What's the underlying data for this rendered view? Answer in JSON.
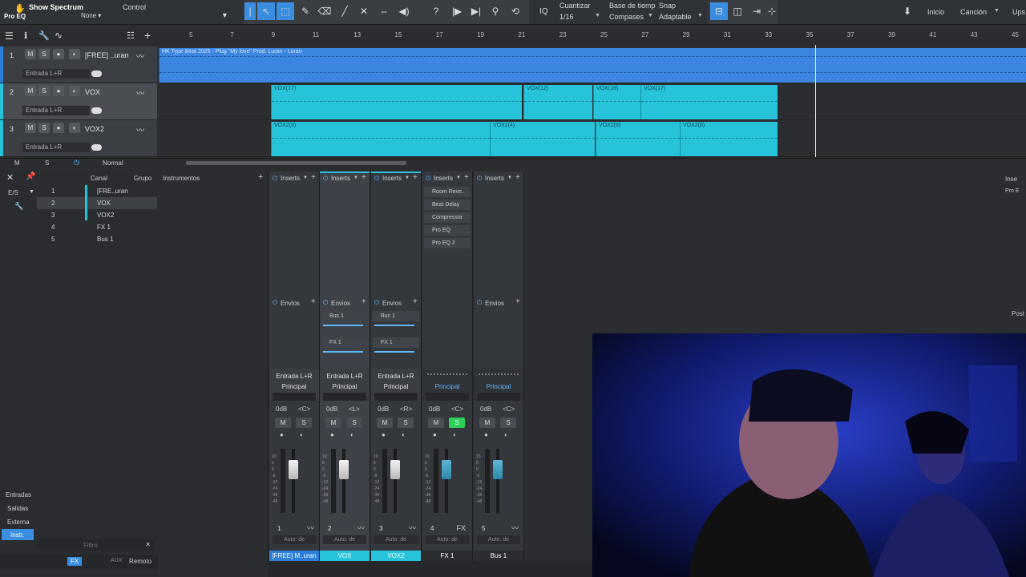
{
  "topbar": {
    "app_label": "Show Spectrum",
    "plugin_label": "Pro EQ",
    "control_label": "Control",
    "none_label": "None ▾",
    "cuantizar_label": "Cuantizar",
    "cuantizar_value": "1/16",
    "base_tiempo_label": "Base de tiemp",
    "base_tiempo_value": "Compases",
    "snap_label": "Snap",
    "snap_value": "Adaptable",
    "inicio": "Inicio",
    "cancion": "Canción",
    "ups": "Ups"
  },
  "ruler": {
    "numbers": [
      "5",
      "7",
      "9",
      "11",
      "13",
      "15",
      "17",
      "19",
      "21",
      "23",
      "25",
      "27",
      "29",
      "31",
      "33",
      "35",
      "37",
      "39",
      "41",
      "43",
      "45"
    ]
  },
  "tracks": [
    {
      "num": "1",
      "name": "[FREE] ..uran",
      "input": "Entrada L+R",
      "m": "M",
      "s": "S",
      "clip_label": "HK Type Beat 2025 - Plug \"My love\" Prod. Luran - Luran"
    },
    {
      "num": "2",
      "name": "VOX",
      "input": "Entrada L+R",
      "m": "M",
      "s": "S",
      "clips": [
        "VOX(17)",
        "VOX(12)",
        "VOX(18)",
        "VOX(17)"
      ]
    },
    {
      "num": "3",
      "name": "VOX2",
      "input": "Entrada L+R",
      "m": "M",
      "s": "S",
      "clips": [
        "VOX2(3)",
        "VOX2(4)",
        "VOX2(9)",
        "VOX2(8)"
      ]
    }
  ],
  "arrange_footer": {
    "m": "M",
    "s": "S",
    "mode": "Normal"
  },
  "mixer_left": {
    "es": "E/S",
    "canal": "Canal",
    "grupo": "Grupo",
    "instrumentos": "Instrumentos",
    "channels": [
      {
        "num": "1",
        "name": "[FRE..uran"
      },
      {
        "num": "2",
        "name": "VOX"
      },
      {
        "num": "3",
        "name": "VOX2"
      },
      {
        "num": "4",
        "name": "FX 1"
      },
      {
        "num": "5",
        "name": "Bus 1"
      }
    ],
    "nav": [
      "Entradas",
      "Salidas",
      "Externa",
      "Instr."
    ],
    "filtro": "Filtro",
    "remoto": "Remoto",
    "fx": "FX",
    "aux": "AUX"
  },
  "strips": [
    {
      "inserts_label": "Inserts",
      "envios_label": "Envios",
      "in": "Entrada L+R",
      "out": "Principal",
      "db": "0dB",
      "pan": "<C>",
      "m": "M",
      "s": "S",
      "num": "1",
      "auto": "Auto: de",
      "name": "[FREE] M..uran",
      "name_color": "#2b7fd8"
    },
    {
      "inserts_label": "Inserts",
      "envios_label": "Envios",
      "sends": [
        "Bus 1",
        "FX 1"
      ],
      "in": "Entrada L+R",
      "out": "Principal",
      "db": "0dB",
      "pan": "<L>",
      "m": "M",
      "s": "S",
      "num": "2",
      "auto": "Auto: de",
      "name": "VOX",
      "name_color": "#27c3da"
    },
    {
      "inserts_label": "Inserts",
      "envios_label": "Envios",
      "sends": [
        "Bus 1",
        "FX 1"
      ],
      "in": "Entrada L+R",
      "out": "Principal",
      "db": "0dB",
      "pan": "<R>",
      "m": "M",
      "s": "S",
      "num": "3",
      "auto": "Auto: de",
      "name": "VOX2",
      "name_color": "#27c3da"
    },
    {
      "inserts_label": "Inserts",
      "envios_label": "",
      "inserts": [
        "Room Reve..",
        "Beat Delay",
        "Compressor",
        "Pro EQ",
        "Pro EQ 2"
      ],
      "out": "Principal",
      "db": "0dB",
      "pan": "<C>",
      "m": "M",
      "s": "S",
      "num": "4",
      "type": "FX",
      "auto": "Auto: de",
      "name": "FX 1",
      "name_color": "#2b2d30"
    },
    {
      "inserts_label": "Inserts",
      "envios_label": "Envios",
      "out": "Principal",
      "db": "0dB",
      "pan": "<C>",
      "m": "M",
      "s": "S",
      "num": "5",
      "auto": "Auto: de",
      "name": "Bus 1",
      "name_color": "#2b2d30"
    }
  ],
  "right_panel": {
    "insert": "Inse",
    "pro": "Pro E",
    "post": "Post"
  }
}
